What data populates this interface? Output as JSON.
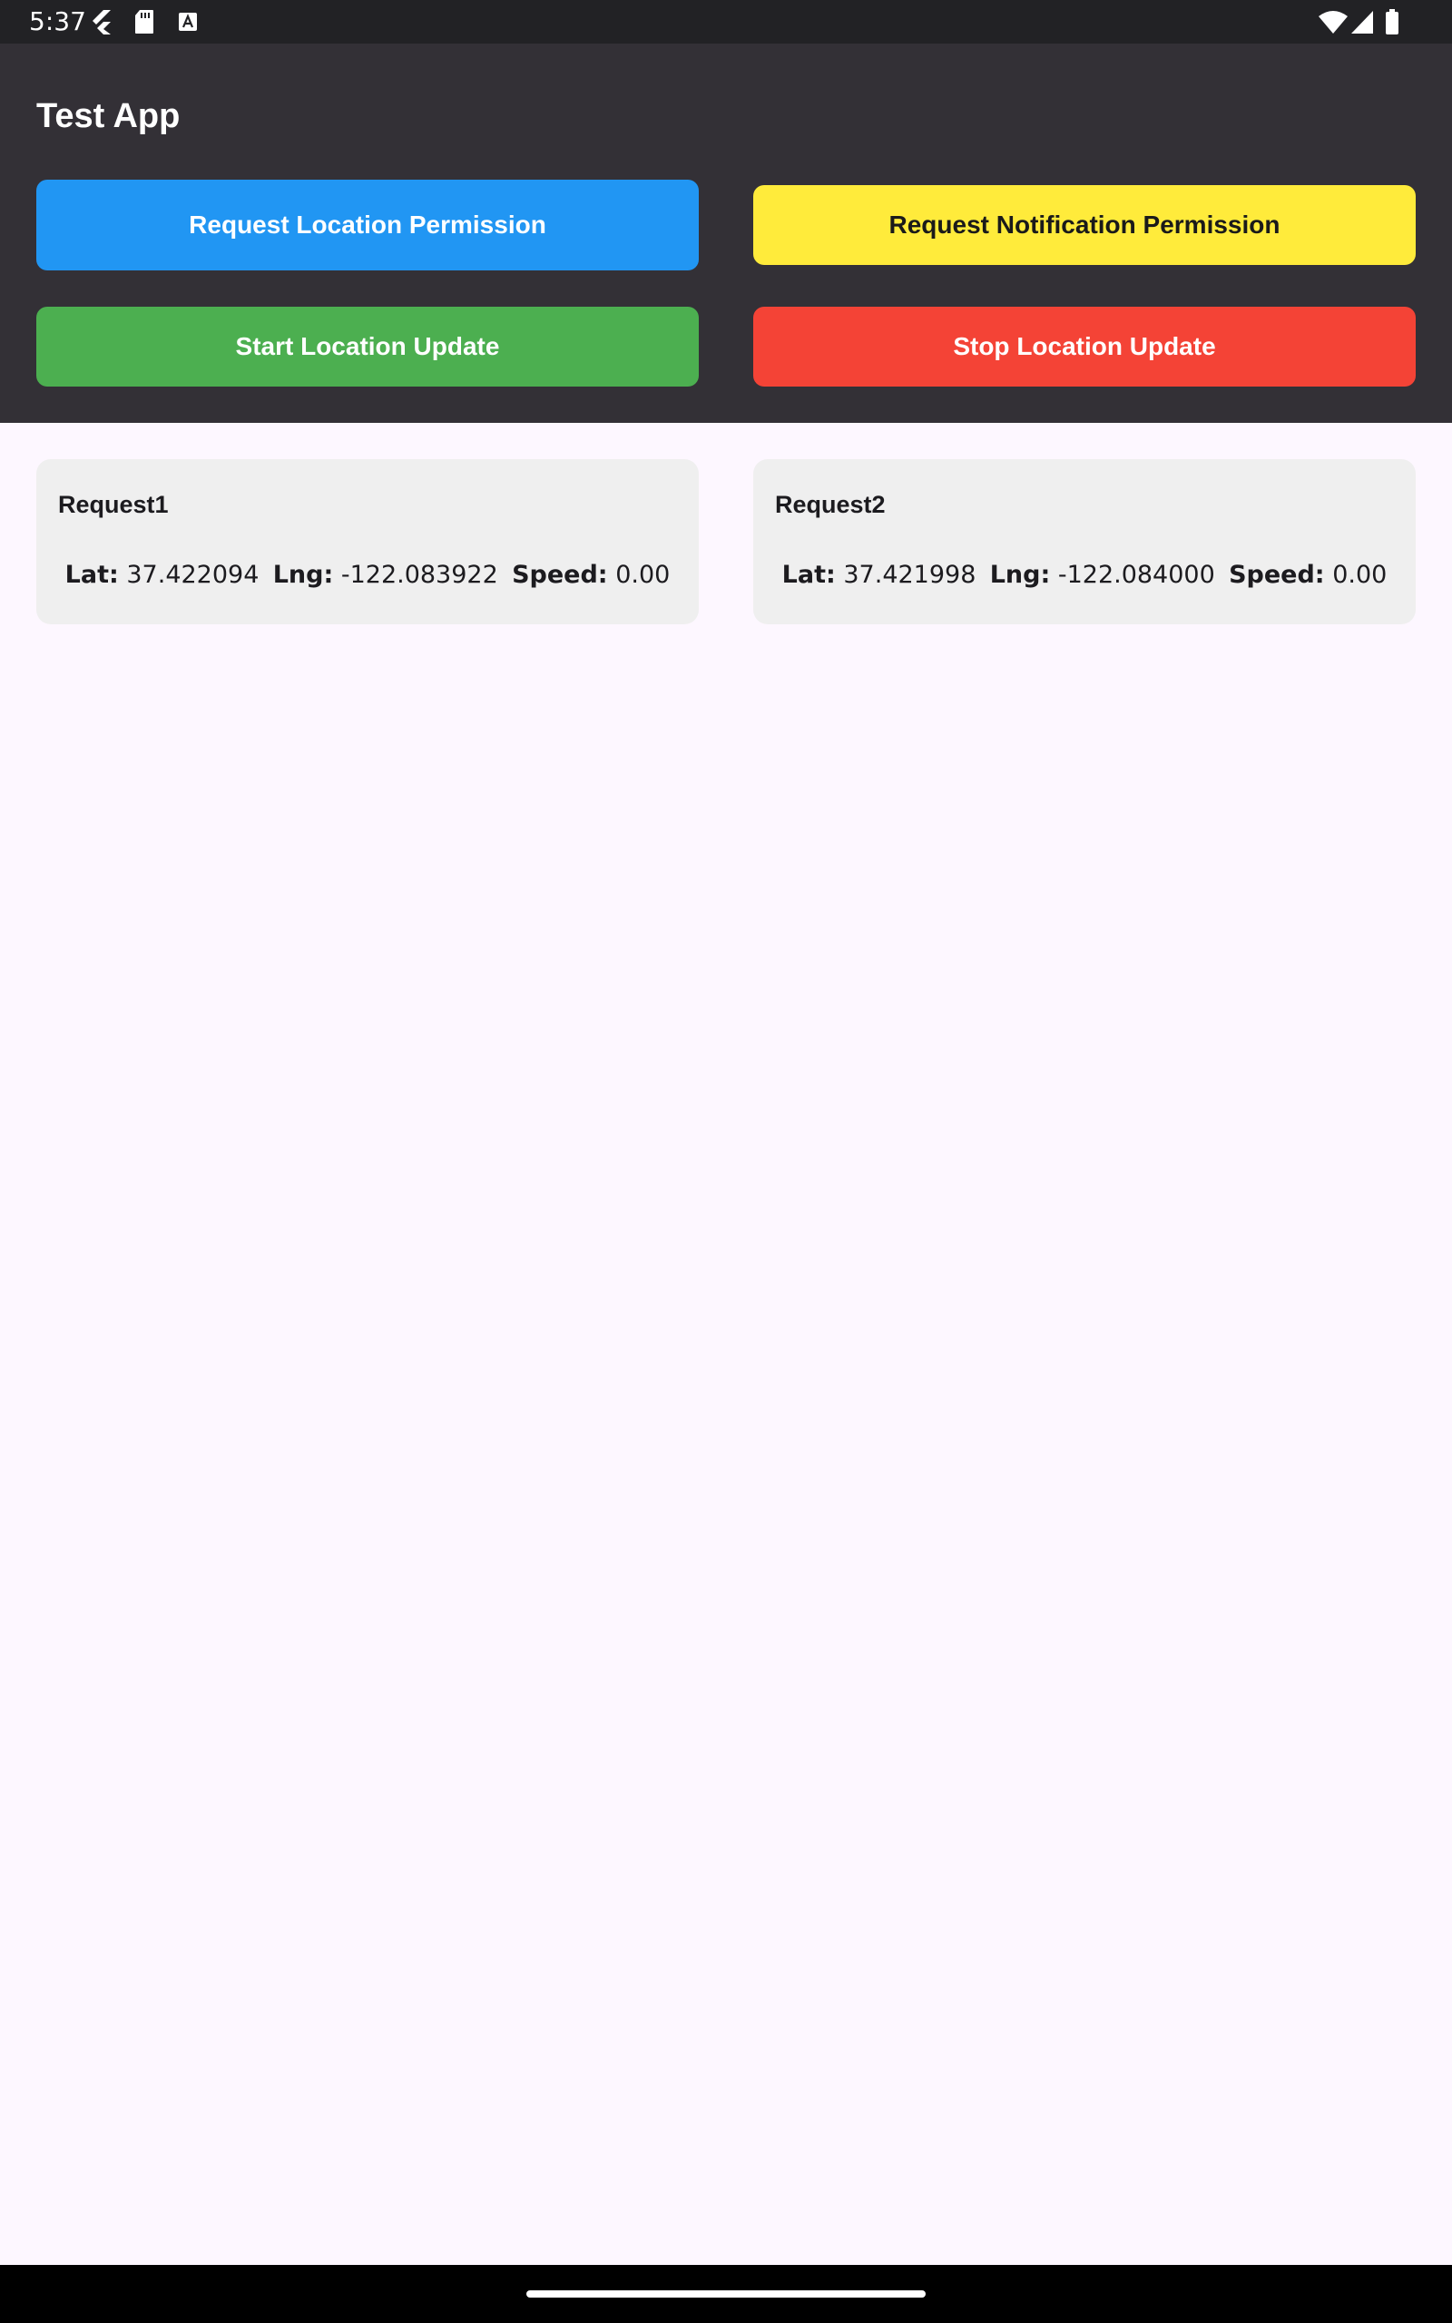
{
  "status_bar": {
    "time": "5:37"
  },
  "app": {
    "title": "Test App"
  },
  "buttons": {
    "request_location": "Request Location Permission",
    "request_notification": "Request Notification Permission",
    "start_location": "Start Location Update",
    "stop_location": "Stop Location Update"
  },
  "requests": [
    {
      "title": "Request1",
      "lat_label": "Lat:",
      "lat": "37.422094",
      "lng_label": "Lng:",
      "lng": "-122.083922",
      "speed_label": "Speed:",
      "speed": "0.00"
    },
    {
      "title": "Request2",
      "lat_label": "Lat:",
      "lat": "37.421998",
      "lng_label": "Lng:",
      "lng": "-122.084000",
      "speed_label": "Speed:",
      "speed": "0.00"
    }
  ],
  "colors": {
    "location_button": "#2196f3",
    "notification_button": "#ffeb3b",
    "start_button": "#4caf50",
    "stop_button": "#f44336",
    "header_background": "#333036"
  }
}
